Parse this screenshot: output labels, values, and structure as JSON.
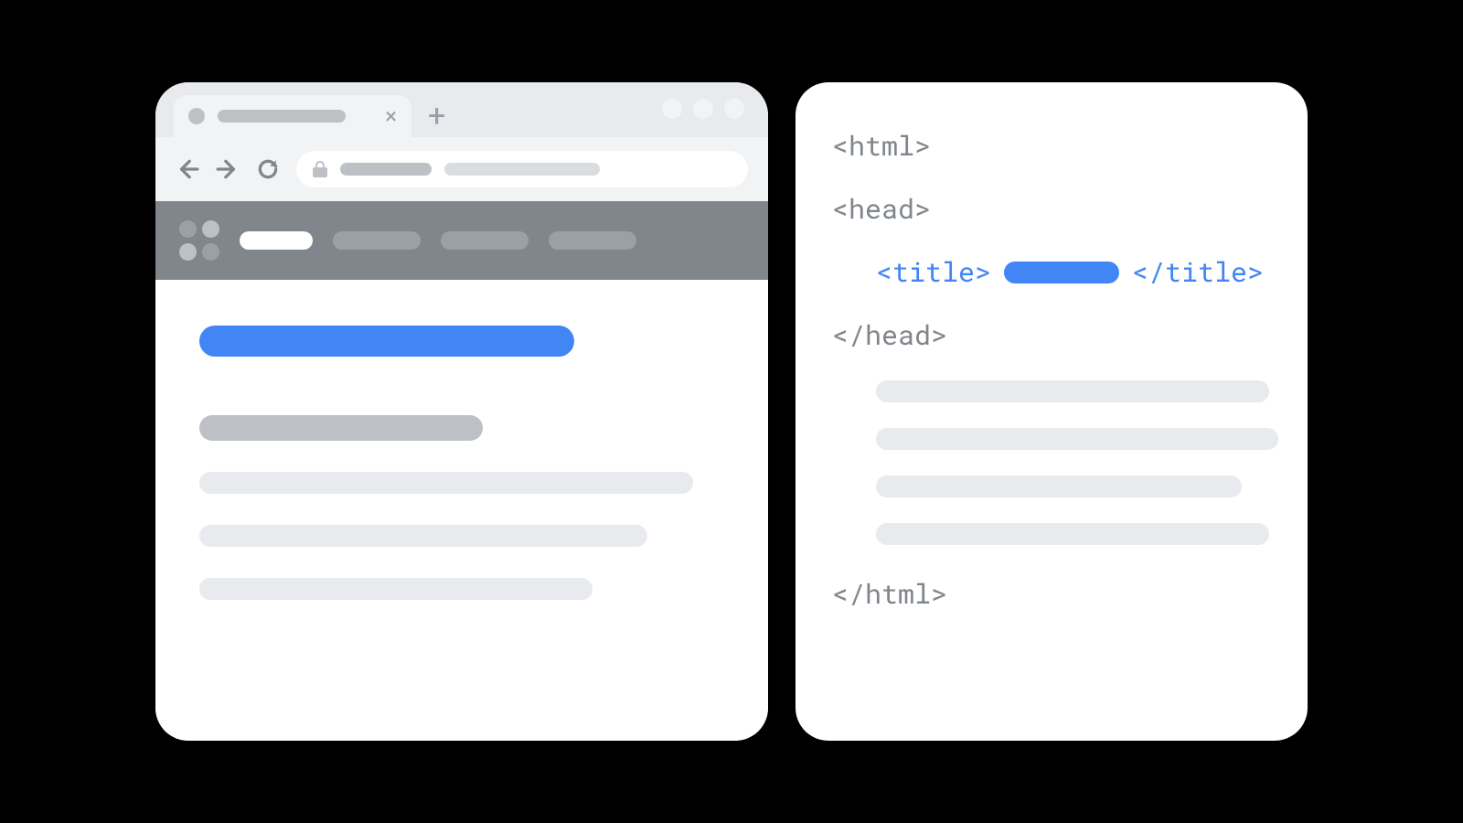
{
  "colors": {
    "accent_blue": "#4285f4",
    "grey_text": "#80868b",
    "black_bg": "#000000"
  },
  "browser": {
    "tab_close_glyph": "×",
    "new_tab_glyph": "+"
  },
  "code": {
    "html_open": "<html>",
    "head_open": "<head>",
    "title_open": "<title>",
    "title_close": "</title>",
    "head_close": "</head>",
    "html_close": "</html>"
  }
}
